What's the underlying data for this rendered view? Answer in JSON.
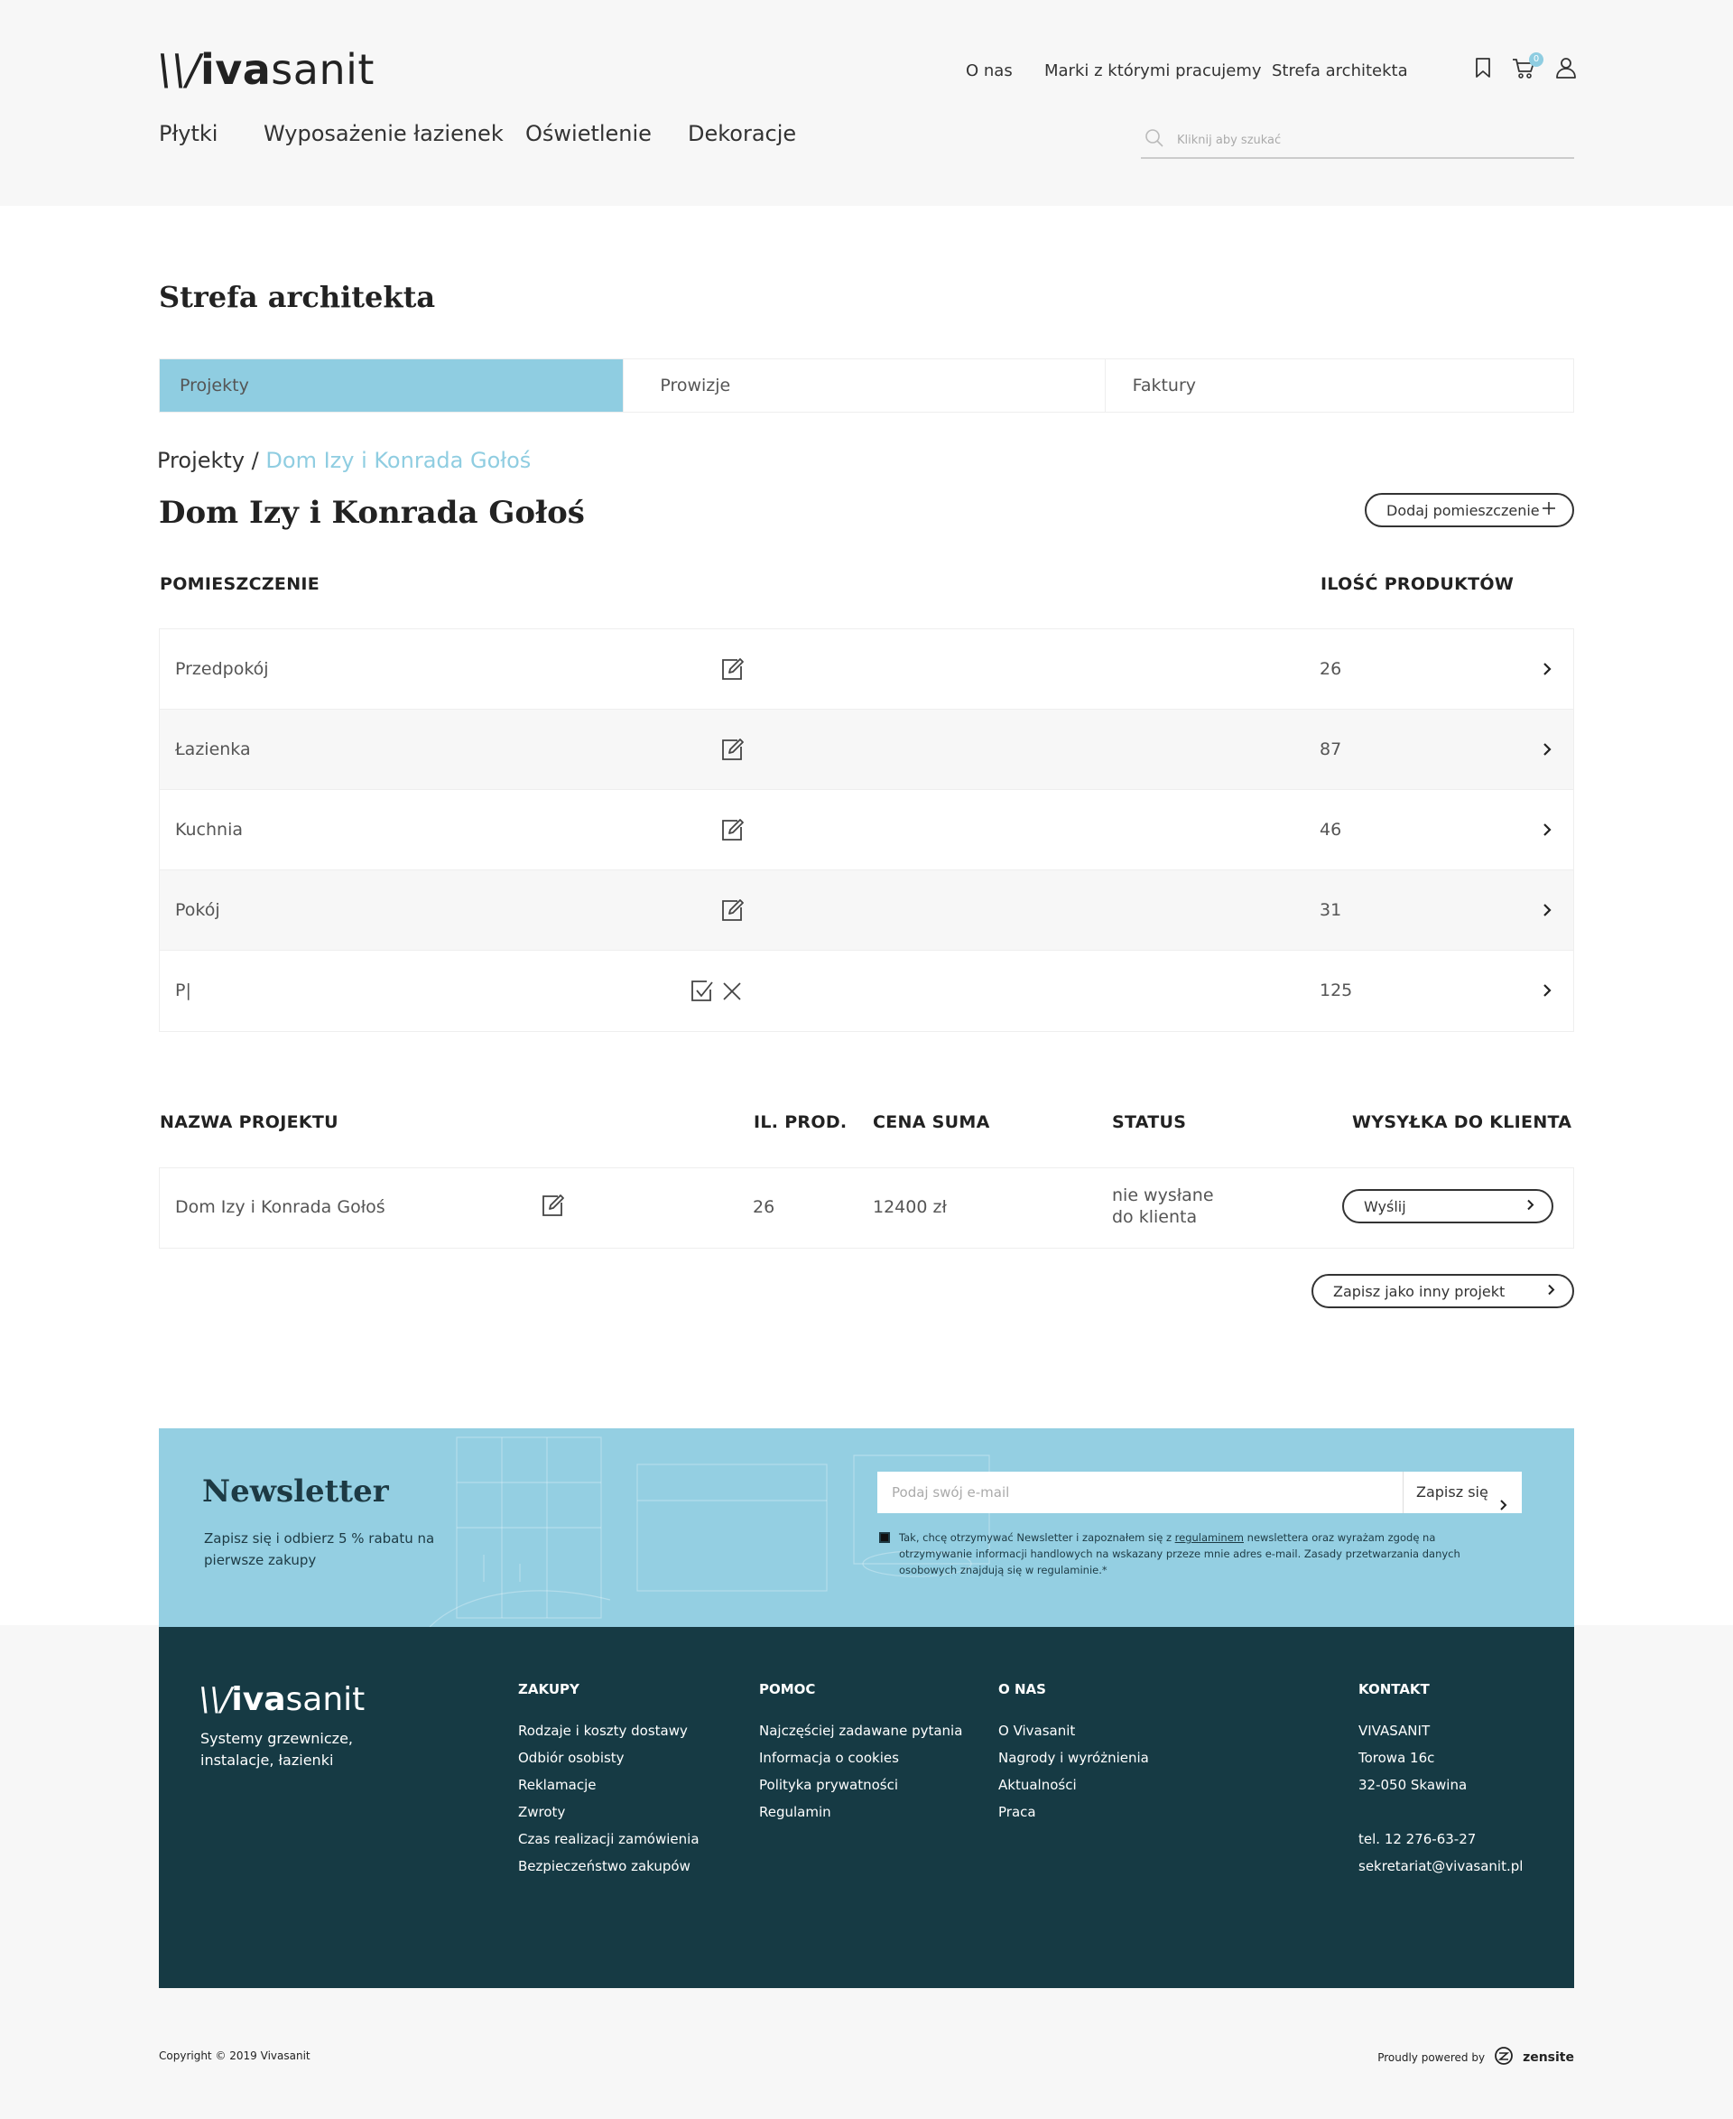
{
  "header": {
    "logo": {
      "prefix": "\\\\/",
      "bold": "iva",
      "rest": "sanit"
    },
    "top_links": [
      "O nas",
      "Marki z którymi pracujemy",
      "Strefa architekta"
    ],
    "nav": [
      "Płytki",
      "Wyposażenie łazienek",
      "Oświetlenie",
      "Dekoracje"
    ],
    "search_placeholder": "Kliknij aby szukać",
    "cart_count": "0"
  },
  "page": {
    "title": "Strefa architekta",
    "tabs": [
      {
        "label": "Projekty",
        "active": true
      },
      {
        "label": "Prowizje",
        "active": false
      },
      {
        "label": "Faktury",
        "active": false
      }
    ],
    "breadcrumb": {
      "root": "Projekty",
      "separator": "/",
      "current": "Dom Izy i Konrada Gołoś"
    },
    "project_title": "Dom Izy i Konrada Gołoś",
    "add_room_label": "Dodaj pomieszczenie"
  },
  "rooms_table": {
    "headers": {
      "room": "POMIESZCZENIE",
      "count": "ILOŚĆ PRODUKTÓW"
    },
    "rows": [
      {
        "name": "Przedpokój",
        "count": "26"
      },
      {
        "name": "Łazienka",
        "count": "87"
      },
      {
        "name": "Kuchnia",
        "count": "46"
      },
      {
        "name": "Pokój",
        "count": "31"
      },
      {
        "name": "P|",
        "count": "125",
        "editing": true
      }
    ]
  },
  "project_table": {
    "headers": {
      "name": "NAZWA PROJEKTU",
      "products": "IL. PROD.",
      "price": "CENA SUMA",
      "status": "STATUS",
      "shipping": "WYSYŁKA DO KLIENTA"
    },
    "row": {
      "name": "Dom Izy i Konrada Gołoś",
      "products": "26",
      "price": "12400 zł",
      "status_line1": "nie wysłane",
      "status_line2": "do klienta",
      "send_label": "Wyślij"
    },
    "save_as_label": "Zapisz jako inny projekt"
  },
  "newsletter": {
    "title": "Newsletter",
    "subtitle": "Zapisz się i odbierz 5 % rabatu na pierwsze zakupy",
    "email_placeholder": "Podaj swój e-mail",
    "submit_label": "Zapisz się",
    "consent_before": "Tak, chcę otrzymywać Newsletter i zapoznałem się z ",
    "consent_link": "regulaminem",
    "consent_after": " newslettera oraz wyrażam zgodę na otrzymywanie informacji handlowych na wskazany przeze mnie adres e-mail. Zasady przetwarzania danych osobowych znajdują się w regulaminie.*"
  },
  "footer": {
    "tagline": "Systemy grzewnicze, instalacje, łazienki",
    "columns": {
      "zakupy": {
        "heading": "ZAKUPY",
        "items": [
          "Rodzaje i koszty dostawy",
          "Odbiór osobisty",
          "Reklamacje",
          "Zwroty",
          "Czas realizacji zamówienia",
          "Bezpieczeństwo zakupów"
        ]
      },
      "pomoc": {
        "heading": "POMOC",
        "items": [
          "Najczęściej zadawane pytania",
          "Informacja o cookies",
          "Polityka prywatności",
          "Regulamin"
        ]
      },
      "onas": {
        "heading": "O NAS",
        "items": [
          "O Vivasanit",
          "Nagrody i wyróżnienia",
          "Aktualności",
          "Praca"
        ]
      },
      "kontakt": {
        "heading": "KONTAKT",
        "company": "VIVASANIT",
        "street": "Torowa 16c",
        "city": "32-050 Skawina",
        "phone": "tel. 12 276-63-27",
        "email": "sekretariat@vivasanit.pl"
      }
    }
  },
  "bottom": {
    "copyright": "Copyright © 2019 Vivasanit",
    "powered_by": "Proudly powered by",
    "powered_brand": "zensite"
  },
  "colors": {
    "accent": "#8fcde1",
    "footer_bg": "#163a44",
    "text": "#333333"
  }
}
